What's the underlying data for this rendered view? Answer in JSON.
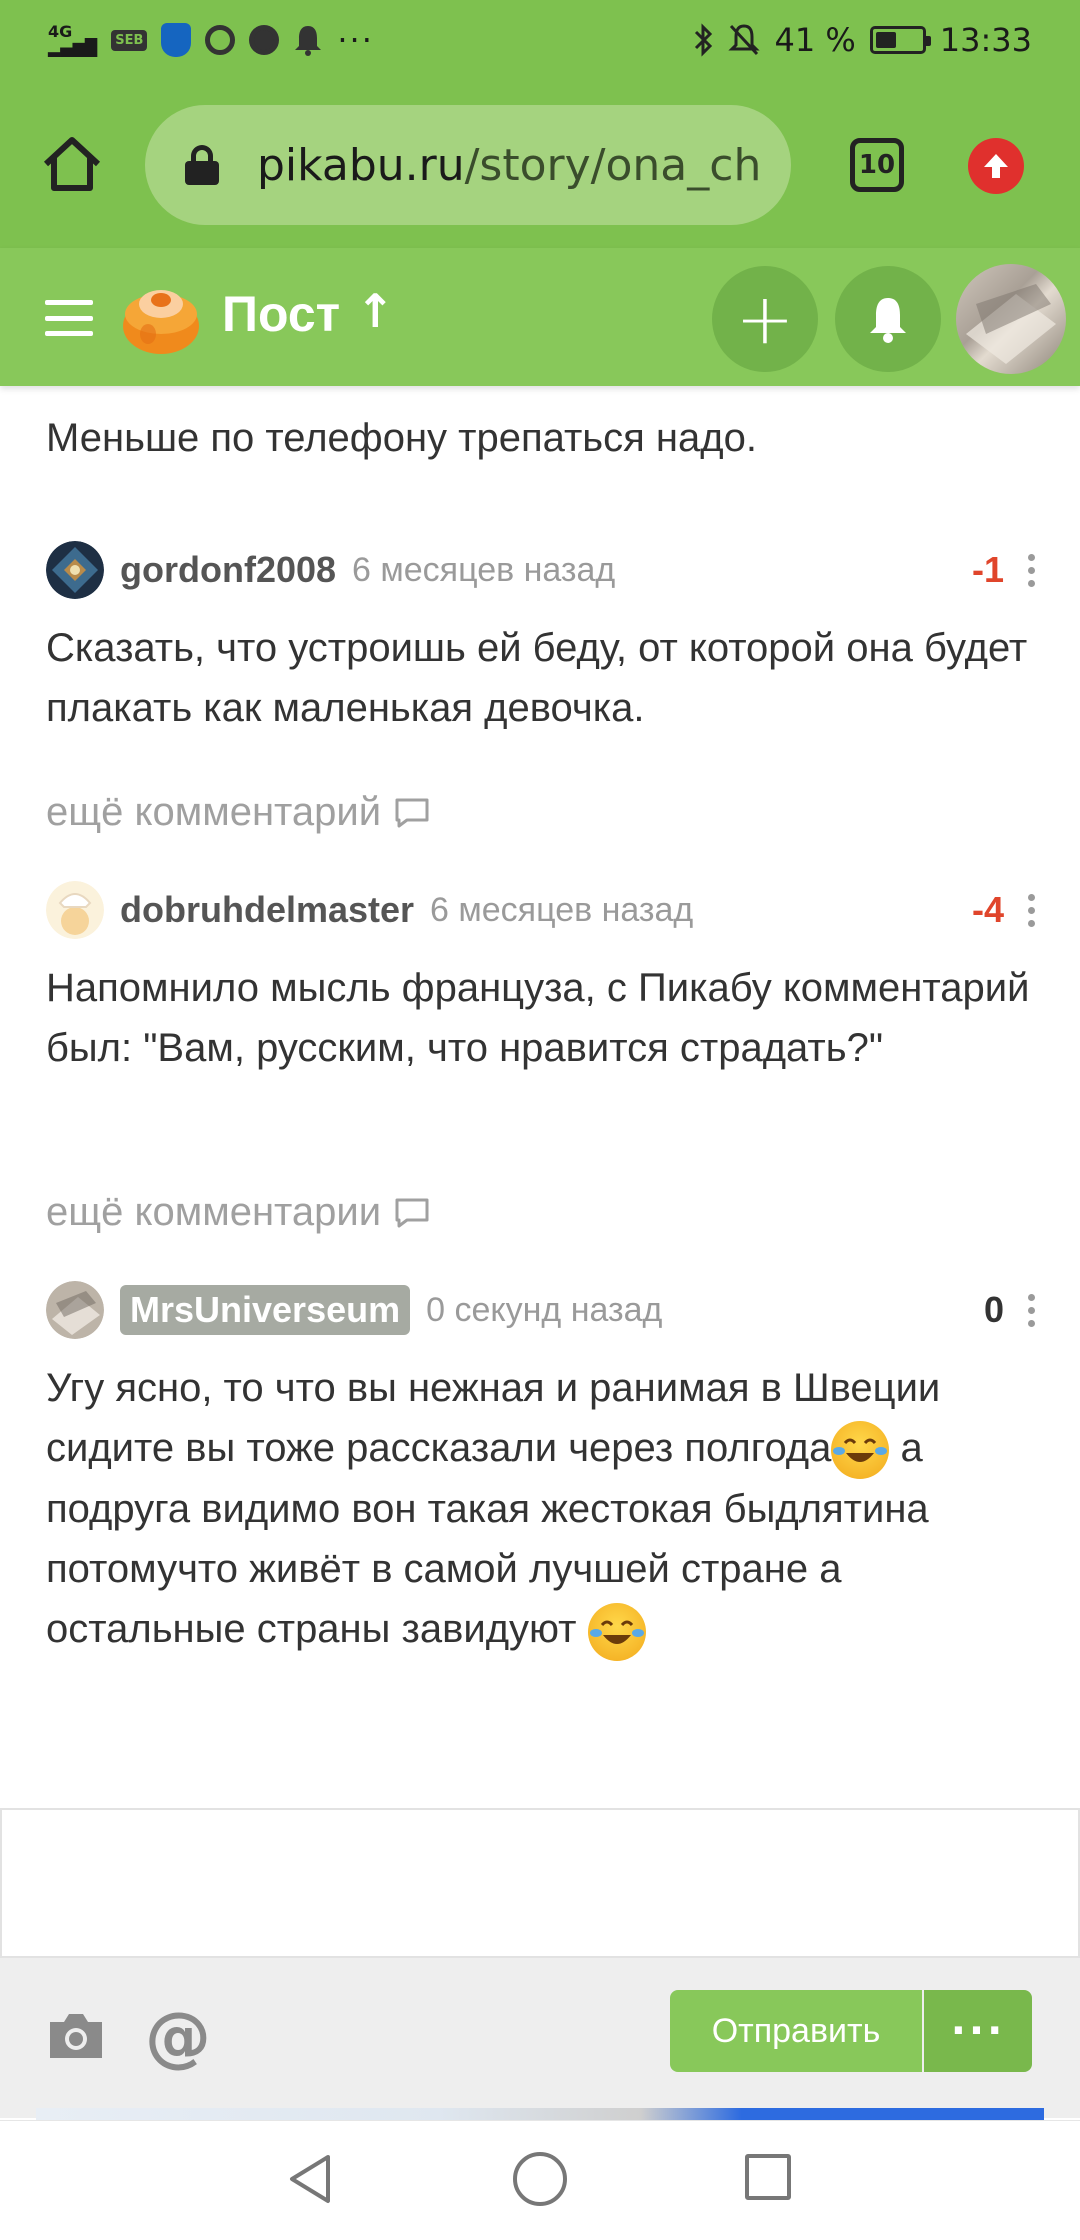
{
  "status_bar": {
    "network": "4G",
    "seb_badge": "SEB",
    "icons_left": [
      "signal-icon",
      "seb-icon",
      "shield-icon",
      "chrome-icon",
      "facebook-icon",
      "notification-bell-icon",
      "more-icon"
    ],
    "more": "···",
    "battery_percent": "41 %",
    "battery_level": 0.41,
    "time": "13:33"
  },
  "browser": {
    "url_host": "pikabu.ru",
    "url_path": "/story/ona_ch",
    "tab_count": "10"
  },
  "header": {
    "title": "Пост",
    "up_arrow": "↑",
    "add": "+"
  },
  "comments": {
    "prev_text": "Меньше по телефону трепаться надо.",
    "c1": {
      "user": "gordonf2008",
      "time": "6 месяцев назад",
      "rating": "-1",
      "text": "Сказать, что устроишь ей беду, от которой она будет плакать как маленькая девочка."
    },
    "more1": "ещё комментарий",
    "c2": {
      "user": "dobruhdelmaster",
      "time": "6 месяцев назад",
      "rating": "-4",
      "text": "Напомнило мысль француза, с Пикабу комментарий был: \"Вам, русским, что нравится страдать?\""
    },
    "more2": "ещё комментарии",
    "c3": {
      "user": "MrsUniverseum",
      "time": "0 секунд назад",
      "rating": "0",
      "text_part1": "Угу ясно, то что вы нежная и ранимая в Швеции сидите вы тоже рассказали через полгода",
      "text_part2": " а подруга видимо вон такая жестокая быдлятина потомучто живёт в самой лучшей стране а остальные страны завидуют "
    }
  },
  "reply": {
    "send_label": "Отправить",
    "more_label": "···",
    "at_symbol": "@"
  }
}
